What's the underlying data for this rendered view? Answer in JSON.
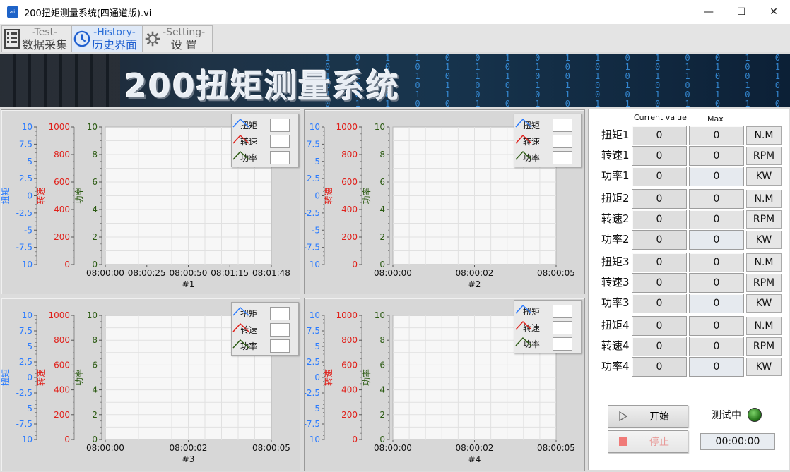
{
  "window": {
    "title": "200扭矩测量系统(四通道版).vi",
    "app_icon_text": "ai",
    "minimize": "—",
    "maximize": "☐",
    "close": "✕"
  },
  "tabs": [
    {
      "en": "-Test-",
      "cn": "数据采集"
    },
    {
      "en": "-History-",
      "cn": "历史界面"
    },
    {
      "en": "-Setting-",
      "cn": "设  置"
    }
  ],
  "banner": {
    "title": "200扭矩测量系统"
  },
  "colors": {
    "torque": "#2a7bff",
    "speed": "#e0201a",
    "power": "#2b5a12",
    "led_on": "#3fa52b"
  },
  "axis_labels": {
    "torque": "扭矩",
    "speed": "转速",
    "power": "功率"
  },
  "legend": [
    {
      "name": "扭矩",
      "icon": "torque-line-icon"
    },
    {
      "name": "转速",
      "icon": "speed-line-icon"
    },
    {
      "name": "功率",
      "icon": "power-line-icon"
    }
  ],
  "chart_data": [
    {
      "type": "line",
      "title": "#1",
      "x_ticks": [
        "08:00:00",
        "08:00:25",
        "08:00:50",
        "08:01:15",
        "08:01:48"
      ],
      "y_torque": {
        "ticks": [
          "10",
          "7.5",
          "5",
          "2.5",
          "0",
          "-2.5",
          "-5",
          "-7.5",
          "-10"
        ],
        "ylim": [
          -10,
          10
        ]
      },
      "y_speed": {
        "ticks": [
          "1000",
          "800",
          "600",
          "400",
          "200",
          "0"
        ],
        "ylim": [
          0,
          1000
        ]
      },
      "y_power": {
        "ticks": [
          "10",
          "8",
          "6",
          "4",
          "2",
          "0"
        ],
        "ylim": [
          0,
          10
        ]
      },
      "series": [
        {
          "name": "扭矩",
          "values": []
        },
        {
          "name": "转速",
          "values": []
        },
        {
          "name": "功率",
          "values": []
        }
      ]
    },
    {
      "type": "line",
      "title": "#2",
      "x_ticks": [
        "08:00:00",
        "08:00:02",
        "08:00:05"
      ],
      "y_torque": {
        "ticks": [
          "10",
          "7.5",
          "5",
          "2.5",
          "0",
          "-2.5",
          "-5",
          "-7.5",
          "-10"
        ],
        "ylim": [
          -10,
          10
        ]
      },
      "y_speed": {
        "ticks": [
          "1000",
          "800",
          "600",
          "400",
          "200",
          "0"
        ],
        "ylim": [
          0,
          1000
        ]
      },
      "y_power": {
        "ticks": [
          "10",
          "8",
          "6",
          "4",
          "2",
          "0"
        ],
        "ylim": [
          0,
          10
        ]
      },
      "series": [
        {
          "name": "扭矩",
          "values": []
        },
        {
          "name": "转速",
          "values": []
        },
        {
          "name": "功率",
          "values": []
        }
      ]
    },
    {
      "type": "line",
      "title": "#3",
      "x_ticks": [
        "08:00:00",
        "08:00:02",
        "08:00:05"
      ],
      "y_torque": {
        "ticks": [
          "10",
          "7.5",
          "5",
          "2.5",
          "0",
          "-2.5",
          "-5",
          "-7.5",
          "-10"
        ],
        "ylim": [
          -10,
          10
        ]
      },
      "y_speed": {
        "ticks": [
          "1000",
          "800",
          "600",
          "400",
          "200",
          "0"
        ],
        "ylim": [
          0,
          1000
        ]
      },
      "y_power": {
        "ticks": [
          "10",
          "8",
          "6",
          "4",
          "2",
          "0"
        ],
        "ylim": [
          0,
          10
        ]
      },
      "series": [
        {
          "name": "扭矩",
          "values": []
        },
        {
          "name": "转速",
          "values": []
        },
        {
          "name": "功率",
          "values": []
        }
      ]
    },
    {
      "type": "line",
      "title": "#4",
      "x_ticks": [
        "08:00:00",
        "08:00:02",
        "08:00:05"
      ],
      "y_torque": {
        "ticks": [
          "10",
          "7.5",
          "5",
          "2.5",
          "0",
          "-2.5",
          "-5",
          "-7.5",
          "-10"
        ],
        "ylim": [
          -10,
          10
        ]
      },
      "y_speed": {
        "ticks": [
          "1000",
          "800",
          "600",
          "400",
          "200",
          "0"
        ],
        "ylim": [
          0,
          1000
        ]
      },
      "y_power": {
        "ticks": [
          "10",
          "8",
          "6",
          "4",
          "2",
          "0"
        ],
        "ylim": [
          0,
          10
        ]
      },
      "series": [
        {
          "name": "扭矩",
          "values": []
        },
        {
          "name": "转速",
          "values": []
        },
        {
          "name": "功率",
          "values": []
        }
      ]
    }
  ],
  "readings": {
    "header_current": "Current value",
    "header_max": "Max",
    "rows": [
      {
        "label": "扭矩1",
        "current": "0",
        "max": "0",
        "unit": "N.M"
      },
      {
        "label": "转速1",
        "current": "0",
        "max": "0",
        "unit": "RPM"
      },
      {
        "label": "功率1",
        "current": "0",
        "max": "0",
        "unit": "KW"
      },
      {
        "label": "扭矩2",
        "current": "0",
        "max": "0",
        "unit": "N.M"
      },
      {
        "label": "转速2",
        "current": "0",
        "max": "0",
        "unit": "RPM"
      },
      {
        "label": "功率2",
        "current": "0",
        "max": "0",
        "unit": "KW"
      },
      {
        "label": "扭矩3",
        "current": "0",
        "max": "0",
        "unit": "N.M"
      },
      {
        "label": "转速3",
        "current": "0",
        "max": "0",
        "unit": "RPM"
      },
      {
        "label": "功率3",
        "current": "0",
        "max": "0",
        "unit": "KW"
      },
      {
        "label": "扭矩4",
        "current": "0",
        "max": "0",
        "unit": "N.M"
      },
      {
        "label": "转速4",
        "current": "0",
        "max": "0",
        "unit": "RPM"
      },
      {
        "label": "功率4",
        "current": "0",
        "max": "0",
        "unit": "KW"
      }
    ]
  },
  "controls": {
    "start_label": "开始",
    "stop_label": "停止",
    "status_label": "测试中",
    "elapsed": "00:00:00"
  }
}
